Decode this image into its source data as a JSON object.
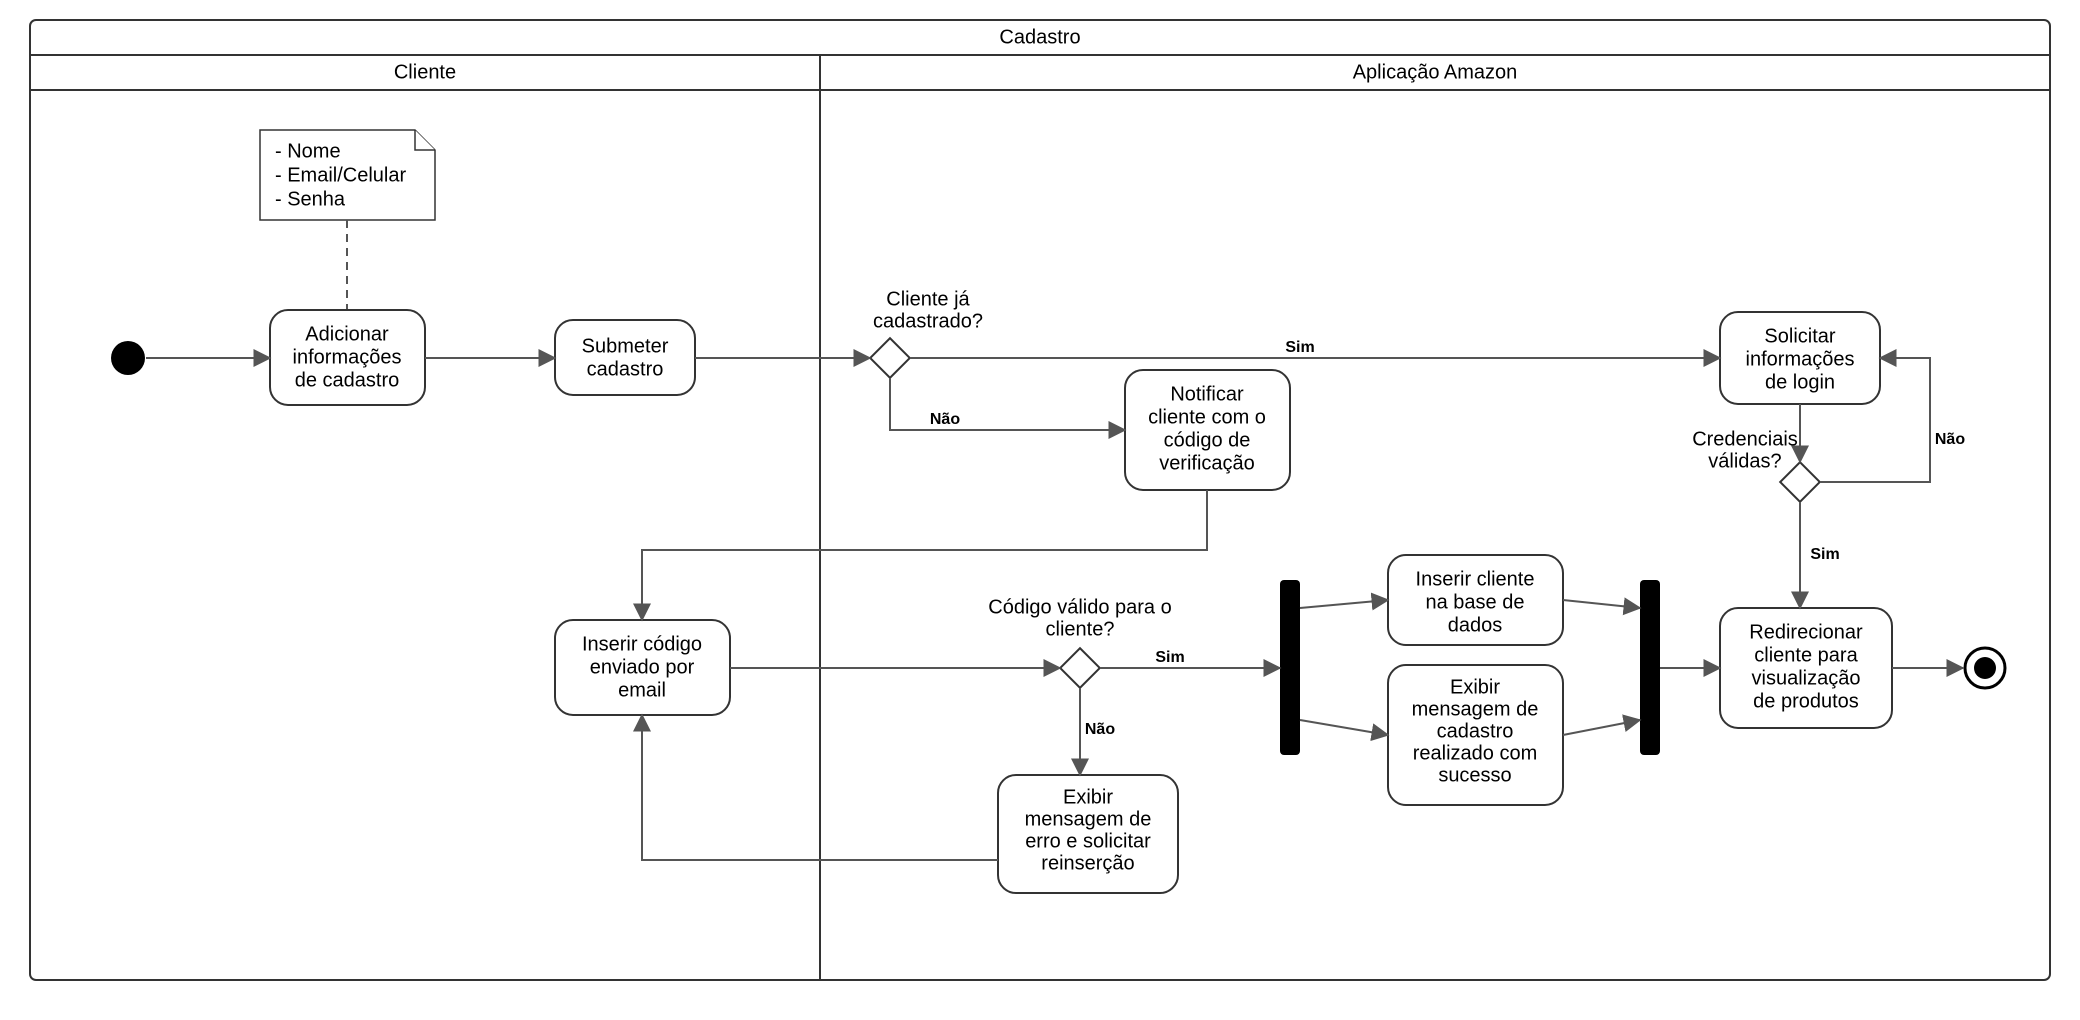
{
  "diagram": {
    "title": "Cadastro",
    "lanes": {
      "left": "Cliente",
      "right": "Aplicação Amazon"
    },
    "note": {
      "line1": "- Nome",
      "line2": "- Email/Celular",
      "line3": "- Senha"
    },
    "activities": {
      "add_info_l1": "Adicionar",
      "add_info_l2": "informações",
      "add_info_l3": "de cadastro",
      "submit_l1": "Submeter",
      "submit_l2": "cadastro",
      "notify_l1": "Notificar",
      "notify_l2": "cliente com o",
      "notify_l3": "código de",
      "notify_l4": "verificação",
      "req_login_l1": "Solicitar",
      "req_login_l2": "informações",
      "req_login_l3": "de login",
      "insert_code_l1": "Inserir código",
      "insert_code_l2": "enviado por",
      "insert_code_l3": "email",
      "insert_db_l1": "Inserir cliente",
      "insert_db_l2": "na base de",
      "insert_db_l3": "dados",
      "show_success_l1": "Exibir",
      "show_success_l2": "mensagem de",
      "show_success_l3": "cadastro",
      "show_success_l4": "realizado com",
      "show_success_l5": "sucesso",
      "show_error_l1": "Exibir",
      "show_error_l2": "mensagem de",
      "show_error_l3": "erro e solicitar",
      "show_error_l4": "reinserção",
      "redirect_l1": "Redirecionar",
      "redirect_l2": "cliente para",
      "redirect_l3": "visualização",
      "redirect_l4": "de produtos"
    },
    "decisions": {
      "d1_l1": "Cliente já",
      "d1_l2": "cadastrado?",
      "d2_l1": "Código válido para o",
      "d2_l2": "cliente?",
      "d3_l1": "Credenciais",
      "d3_l2": "válidas?"
    },
    "edges": {
      "sim": "Sim",
      "nao": "Não"
    }
  }
}
